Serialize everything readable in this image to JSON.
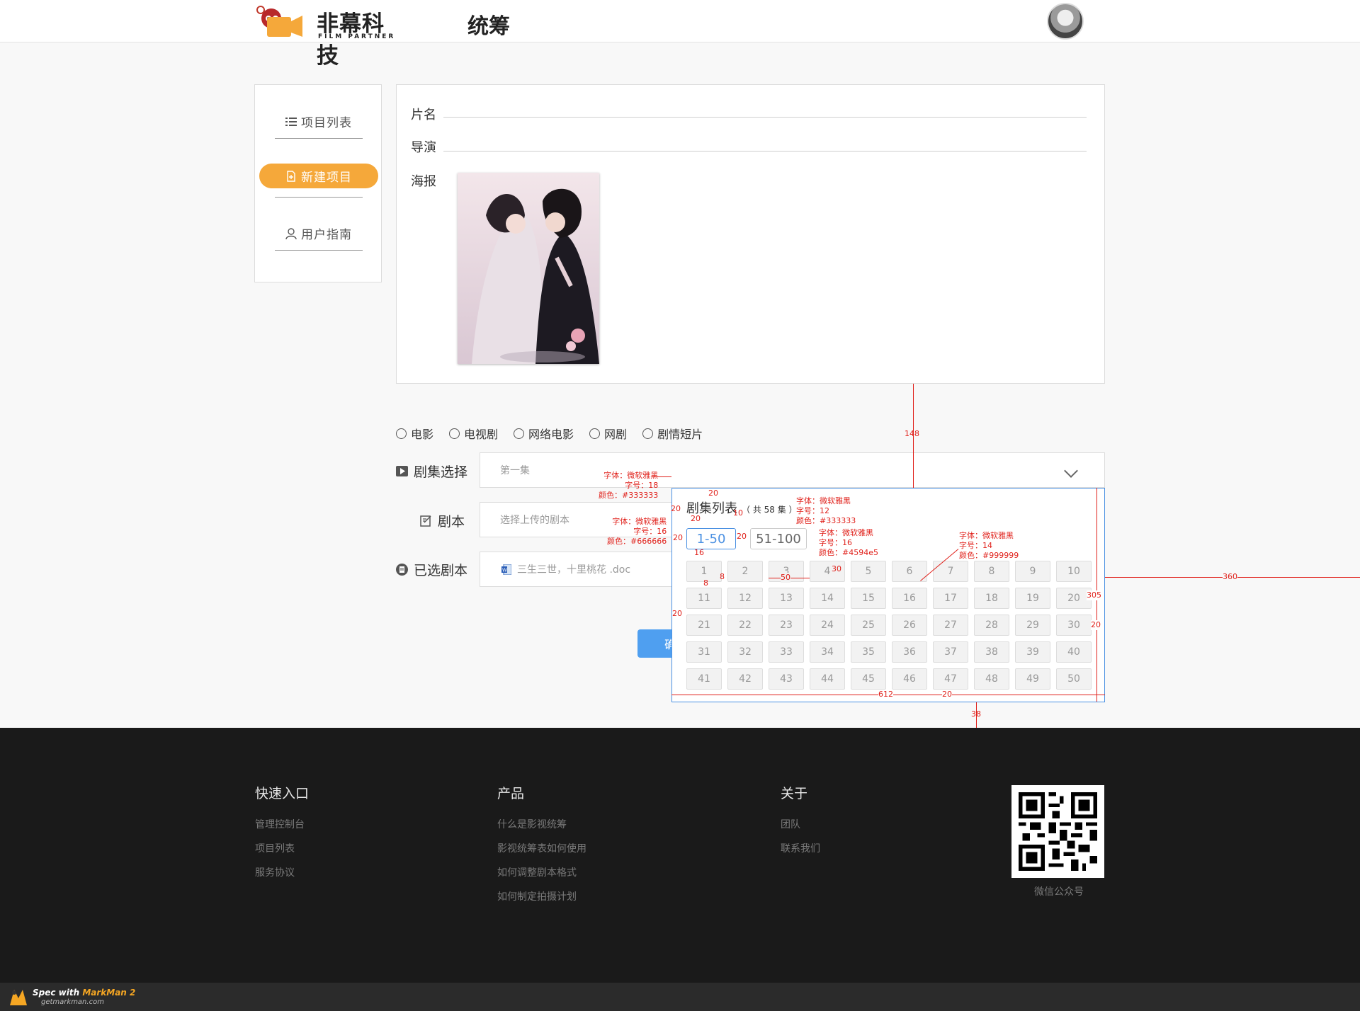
{
  "header": {
    "brand": "非幕科技",
    "brand_sub": "FILM PARTNER",
    "title": "统筹"
  },
  "sidebar": {
    "items": [
      {
        "label": "项目列表",
        "icon": "list-icon"
      },
      {
        "label": "新建项目",
        "icon": "new-file-icon",
        "active": true
      },
      {
        "label": "用户指南",
        "icon": "user-icon"
      }
    ]
  },
  "form": {
    "name_label": "片名",
    "director_label": "导演",
    "poster_label": "海报"
  },
  "types": [
    "电影",
    "电视剧",
    "网络电影",
    "网剧",
    "剧情短片"
  ],
  "episode": {
    "label": "剧集选择",
    "value": "第一集"
  },
  "script": {
    "label": "剧本",
    "placeholder": "选择上传的剧本"
  },
  "selected_script": {
    "label": "已选剧本",
    "file": "三生三世，十里桃花 .doc"
  },
  "confirm_label": "确",
  "episode_popup": {
    "title": "剧集列表",
    "count": "（ 共 58 集 ）",
    "tabs": [
      "1-50",
      "51-100"
    ],
    "episodes": [
      "1",
      "2",
      "3",
      "4",
      "5",
      "6",
      "7",
      "8",
      "9",
      "10",
      "11",
      "12",
      "13",
      "14",
      "15",
      "16",
      "17",
      "18",
      "19",
      "20",
      "21",
      "22",
      "23",
      "24",
      "25",
      "26",
      "27",
      "28",
      "29",
      "30",
      "31",
      "32",
      "33",
      "34",
      "35",
      "36",
      "37",
      "38",
      "39",
      "40",
      "41",
      "42",
      "43",
      "44",
      "45",
      "46",
      "47",
      "48",
      "49",
      "50"
    ]
  },
  "annotations": {
    "a1": "字体：微软雅黑",
    "a1b": "字号：18",
    "a1c": "颜色：#333333",
    "a2": "字体：微软雅黑",
    "a2b": "字号：12",
    "a2c": "颜色：#333333",
    "a3": "字体：微软雅黑",
    "a3b": "字号：16",
    "a3c": "颜色：#666666",
    "a4": "字体：微软雅黑",
    "a4b": "字号：16",
    "a4c": "颜色：#4594e5",
    "a5": "字体：微软雅黑",
    "a5b": "字号：14",
    "a5c": "颜色：#999999",
    "d148": "148",
    "d20a": "20",
    "d10": "10",
    "d20b": "20",
    "d20c": "20",
    "d20d": "20",
    "d20e": "20",
    "d16": "16",
    "d8a": "8",
    "d8b": "8",
    "d50": "50",
    "d30": "30",
    "d305": "305",
    "d360": "360",
    "d20f": "20",
    "d20g": "20",
    "d612": "612",
    "d20h": "20",
    "d38": "38"
  },
  "footer": {
    "cols": [
      {
        "title": "快速入口",
        "links": [
          "管理控制台",
          "项目列表",
          "服务协议"
        ]
      },
      {
        "title": "产品",
        "links": [
          "什么是影视统筹",
          "影视统筹表如何使用",
          "如何调整剧本格式",
          "如何制定拍摄计划"
        ]
      },
      {
        "title": "关于",
        "links": [
          "团队",
          "联系我们"
        ]
      }
    ],
    "qr_caption": "微信公众号"
  },
  "markman": {
    "label_a": "Spec with",
    "label_b": "MarkMan 2",
    "url": "getmarkman.com"
  },
  "colors": {
    "accent": "#f5a83a",
    "primary": "#4a90e2",
    "annotation": "#e0201a",
    "footer_bg": "#1a1a1a"
  }
}
